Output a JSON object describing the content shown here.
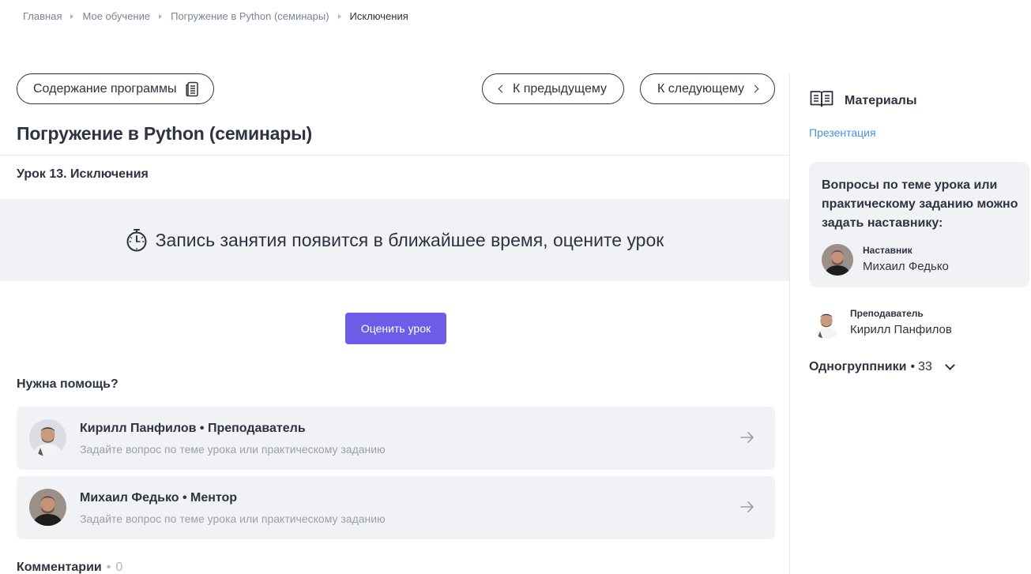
{
  "breadcrumb": {
    "items": [
      "Главная",
      "Мое обучение",
      "Погружение в Python (семинары)"
    ],
    "current": "Исключения"
  },
  "nav": {
    "program_label": "Содержание программы",
    "prev_label": "К предыдущему",
    "next_label": "К следующему"
  },
  "course": {
    "title": "Погружение в Python (семинары)",
    "lesson": "Урок 13. Исключения"
  },
  "banner": {
    "text": "Запись занятия появится в ближайшее время, оцените урок",
    "icon": "stopwatch-icon"
  },
  "rate_button": "Оценить урок",
  "help": {
    "title": "Нужна помощь?",
    "cards": [
      {
        "name": "Кирилл Панфилов • Преподаватель",
        "subtitle": "Задайте вопрос по теме урока или практическому заданию"
      },
      {
        "name": "Михаил Федько • Ментор",
        "subtitle": "Задайте вопрос по теме урока или практическому заданию"
      }
    ]
  },
  "comments": {
    "label": "Комментарии",
    "separator": "•",
    "count": "0"
  },
  "sidebar": {
    "materials_label": "Материалы",
    "presentation_link": "Презентация",
    "question_text": "Вопросы по теме урока или практическому заданию можно задать наставнику:",
    "mentor": {
      "role": "Наставник",
      "name": "Михаил Федько"
    },
    "teacher": {
      "role": "Преподаватель",
      "name": "Кирилл Панфилов"
    },
    "groupmates": {
      "label": "Одногруппники",
      "separator": "•",
      "count": "33"
    }
  },
  "colors": {
    "accent": "#6c5ce7",
    "link": "#4a90e2",
    "panel": "#f1f2f6",
    "text": "#2d3340",
    "muted": "#9aa0ad"
  }
}
